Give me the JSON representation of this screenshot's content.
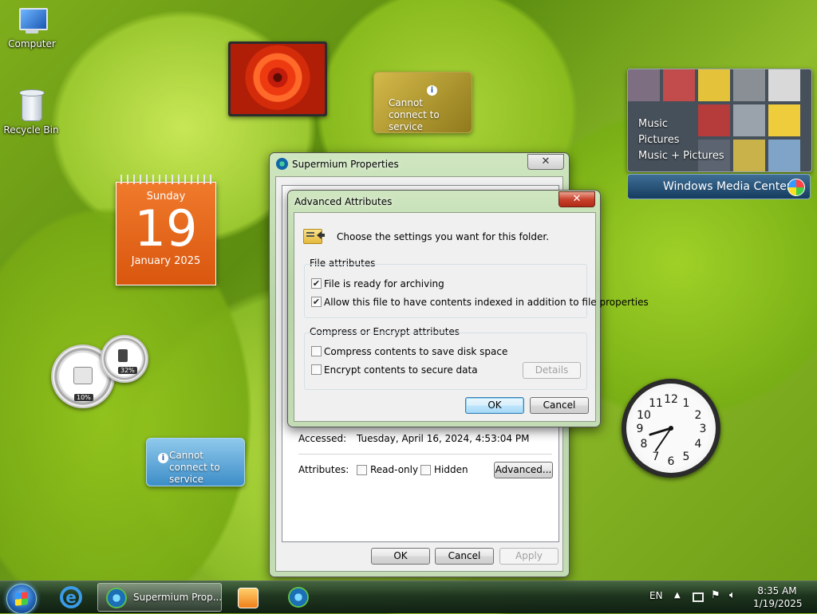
{
  "desktop": {
    "icons": [
      {
        "label": "Computer"
      },
      {
        "label": "Recycle Bin"
      }
    ]
  },
  "gadgets": {
    "weather_top": {
      "message": "Cannot connect to service"
    },
    "weather_bottom": {
      "message": "Cannot connect to service"
    },
    "calendar": {
      "weekday": "Sunday",
      "day": "19",
      "month_year": "January 2025"
    },
    "cpu_meter": {
      "cpu": "10%",
      "memory": "32%"
    },
    "media_center": {
      "menu": [
        "Music",
        "Pictures",
        "Music + Pictures"
      ],
      "title": "Windows Media Center"
    },
    "clock": {
      "numbers": [
        "12",
        "1",
        "2",
        "3",
        "4",
        "5",
        "6",
        "7",
        "8",
        "9",
        "10",
        "11"
      ],
      "time": "8:35"
    }
  },
  "properties_window": {
    "title": "Supermium Properties",
    "accessed_label": "Accessed:",
    "accessed_value": "Tuesday, April 16, 2024, 4:53:04 PM",
    "attributes_label": "Attributes:",
    "readonly_label": "Read-only",
    "hidden_label": "Hidden",
    "advanced_button": "Advanced...",
    "ok": "OK",
    "cancel": "Cancel",
    "apply": "Apply",
    "close": "✕"
  },
  "advanced_dialog": {
    "title": "Advanced Attributes",
    "instruction": "Choose the settings you want for this folder.",
    "file_attributes_heading": "File attributes",
    "archive_label": "File is ready for archiving",
    "archive_checked": true,
    "index_label": "Allow this file to have contents indexed in addition to file properties",
    "index_checked": true,
    "compress_heading": "Compress or Encrypt attributes",
    "compress_label": "Compress contents to save disk space",
    "encrypt_label": "Encrypt contents to secure data",
    "details_button": "Details",
    "ok": "OK",
    "cancel": "Cancel",
    "close": "✕"
  },
  "taskbar": {
    "active_window": "Supermium Prop...",
    "language": "EN",
    "time": "8:35 AM",
    "date": "1/19/2025"
  }
}
